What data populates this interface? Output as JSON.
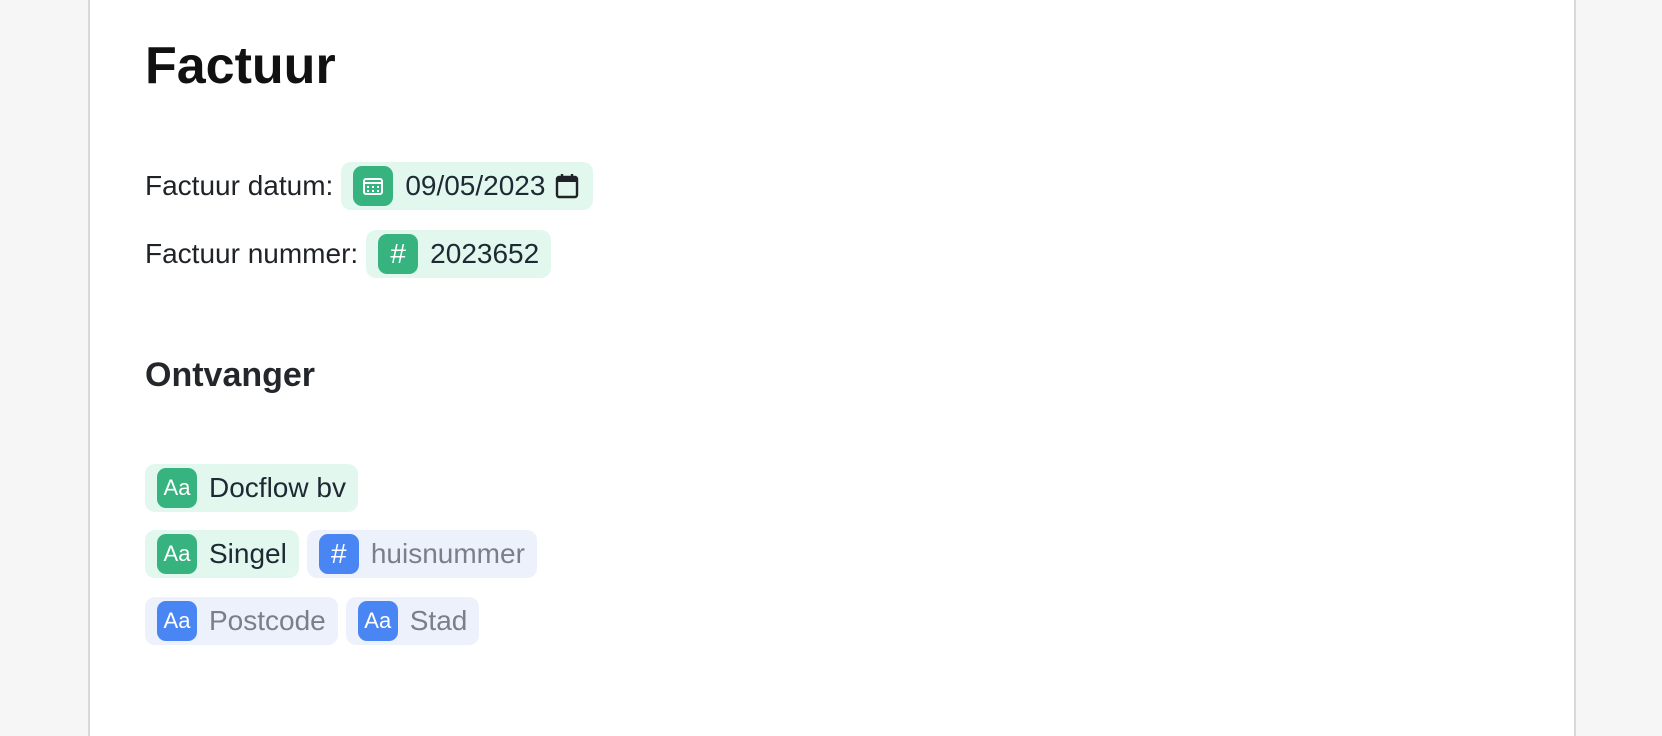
{
  "document": {
    "title": "Factuur",
    "fields": {
      "date_label": "Factuur datum:",
      "date_value": "09/05/2023",
      "number_label": "Factuur nummer:",
      "number_value": "2023652"
    },
    "recipient": {
      "heading": "Ontvanger",
      "company": "Docflow bv",
      "street": "Singel",
      "house_number_placeholder": "huisnummer",
      "postcode_placeholder": "Postcode",
      "city_placeholder": "Stad"
    },
    "icons": {
      "text_icon_glyph": "Aa",
      "number_icon_glyph": "#"
    }
  },
  "colors": {
    "filled_chip_bg": "#e2f8ee",
    "filled_icon": "#36b37e",
    "empty_chip_bg": "#edf1fb",
    "empty_icon": "#4a86f3"
  }
}
